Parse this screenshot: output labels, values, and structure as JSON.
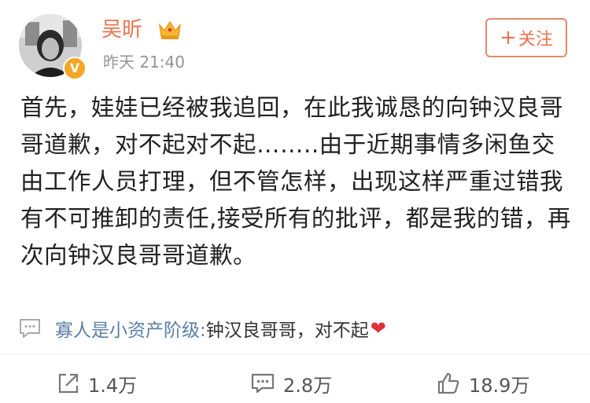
{
  "user": {
    "name": "吴昕",
    "verified_badge": "V",
    "timestamp": "昨天  21:40"
  },
  "follow": {
    "label": "关注",
    "icon": "plus-icon"
  },
  "post": {
    "text": "首先，娃娃已经被我追回，在此我诚恳的向钟汉良哥哥道歉，对不起对不起……..由于近期事情多闲鱼交由工作人员打理，但不管怎样，出现这样严重过错我有不可推卸的责任,接受所有的批评，都是我的错，再次向钟汉良哥哥道歉。"
  },
  "comment": {
    "user": "寡人是小资产阶级:",
    "text": " 钟汉良哥哥，对不起",
    "emoji": "❤"
  },
  "actions": {
    "repost": "1.4万",
    "comments": "2.8万",
    "likes": "18.9万"
  },
  "colors": {
    "accent": "#eb7350",
    "link": "#5b7fa6",
    "muted": "#939393"
  }
}
